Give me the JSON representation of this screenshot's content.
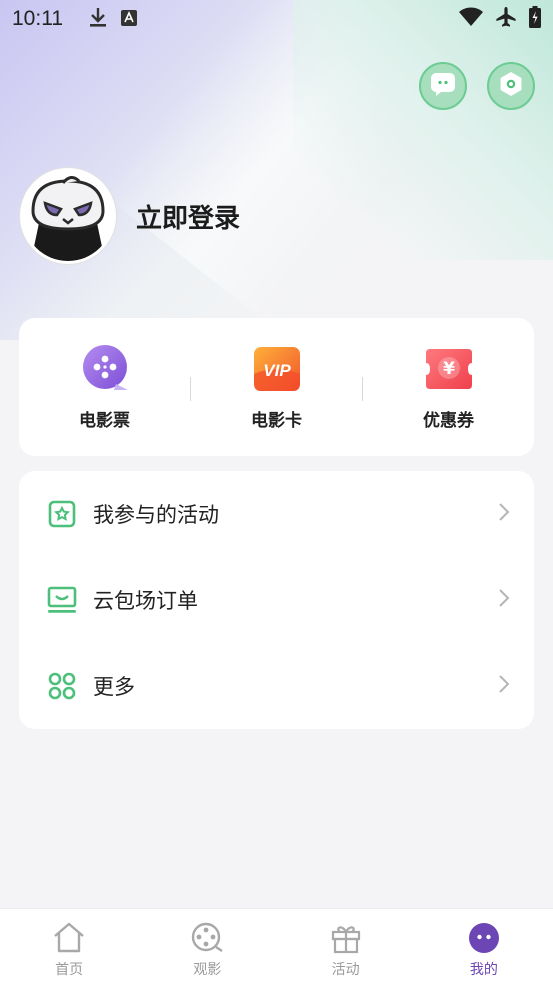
{
  "status_bar": {
    "time": "10:11",
    "icons": [
      "download-icon",
      "font-icon",
      "wifi-icon",
      "airplane-icon",
      "battery-charging-icon"
    ]
  },
  "top_actions": {
    "message_icon": "chat-bubble-icon",
    "settings_icon": "settings-icon"
  },
  "profile": {
    "login_label": "立即登录"
  },
  "quick_links": [
    {
      "label": "电影票",
      "icon": "movie-ticket-icon",
      "color": "#9b6fe0"
    },
    {
      "label": "电影卡",
      "icon": "vip-card-icon",
      "icon_text": "VIP",
      "color": "#f27a2a"
    },
    {
      "label": "优惠券",
      "icon": "coupon-icon",
      "icon_text": "¥",
      "color": "#f0555e"
    }
  ],
  "menu": [
    {
      "label": "我参与的活动",
      "icon": "activity-icon"
    },
    {
      "label": "云包场订单",
      "icon": "cinema-order-icon"
    },
    {
      "label": "更多",
      "icon": "more-grid-icon"
    }
  ],
  "bottom_nav": [
    {
      "label": "首页",
      "icon": "home-icon"
    },
    {
      "label": "观影",
      "icon": "film-reel-icon"
    },
    {
      "label": "活动",
      "icon": "gift-icon"
    },
    {
      "label": "我的",
      "icon": "profile-face-icon",
      "active": true
    }
  ],
  "colors": {
    "accent_green": "#4cc07a",
    "accent_purple": "#6b46b4",
    "background": "#f4f4f6"
  }
}
